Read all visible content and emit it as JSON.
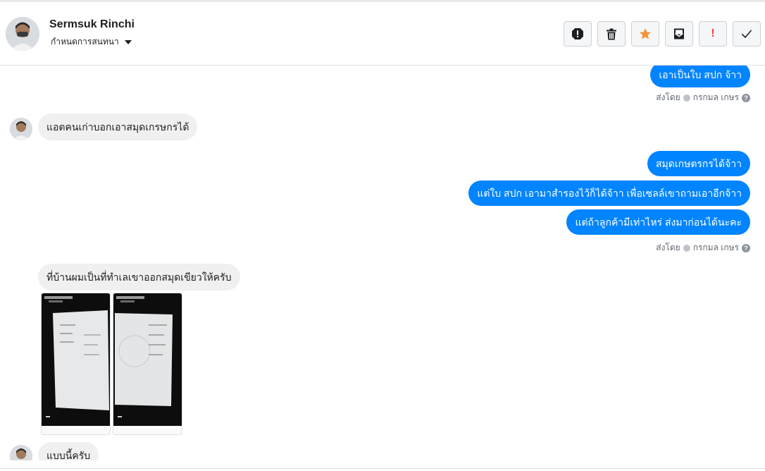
{
  "header": {
    "contact_name": "Sermsuk Rinchi",
    "contact_sub": "กำหนดการสนทนา"
  },
  "actions": [
    {
      "icon": "alert-icon",
      "color": "#1c1e21"
    },
    {
      "icon": "trash-icon",
      "color": "#1c1e21"
    },
    {
      "icon": "star-icon",
      "color": "#f7923a"
    },
    {
      "icon": "mail-envelope-icon",
      "color": "#1c1e21"
    },
    {
      "icon": "exclamation-icon",
      "text": "!",
      "color": "#fa3e3e"
    },
    {
      "icon": "checkmark-icon",
      "color": "#1c1e21"
    }
  ],
  "messages": {
    "out_1": "เอาเป็นใบ สปก จ้าา",
    "sent_by_1": "ส่งโดย",
    "sender_1": "กรกมล เกษร",
    "in_1": "แอตคนเก่าบอกเอาสมุดเกรษกรได้",
    "out_2": "สมุดเกษตรกรได้จ้าา",
    "out_3": "แต่ใบ สปก เอามาสำรองไว้ก็ได้จ้าา เพื่อเซลล์เขาถามเอาอีกจ้าา",
    "out_4": "แต่ถ้าลูกค้ามีเท่าไหร่ ส่งมาก่อนได้นะคะ",
    "sent_by_2": "ส่งโดย",
    "sender_2": "กรกมล เกษร",
    "in_2": "ที่บ้านผมเป็นที่ทำเลเขาออกสมุดเขียวให้ครับ",
    "in_3": "แบบนี้ครับ"
  },
  "help_glyph": "?",
  "colors": {
    "outgoing_bubble": "#0084ff",
    "incoming_bubble": "#f1f0f0"
  }
}
